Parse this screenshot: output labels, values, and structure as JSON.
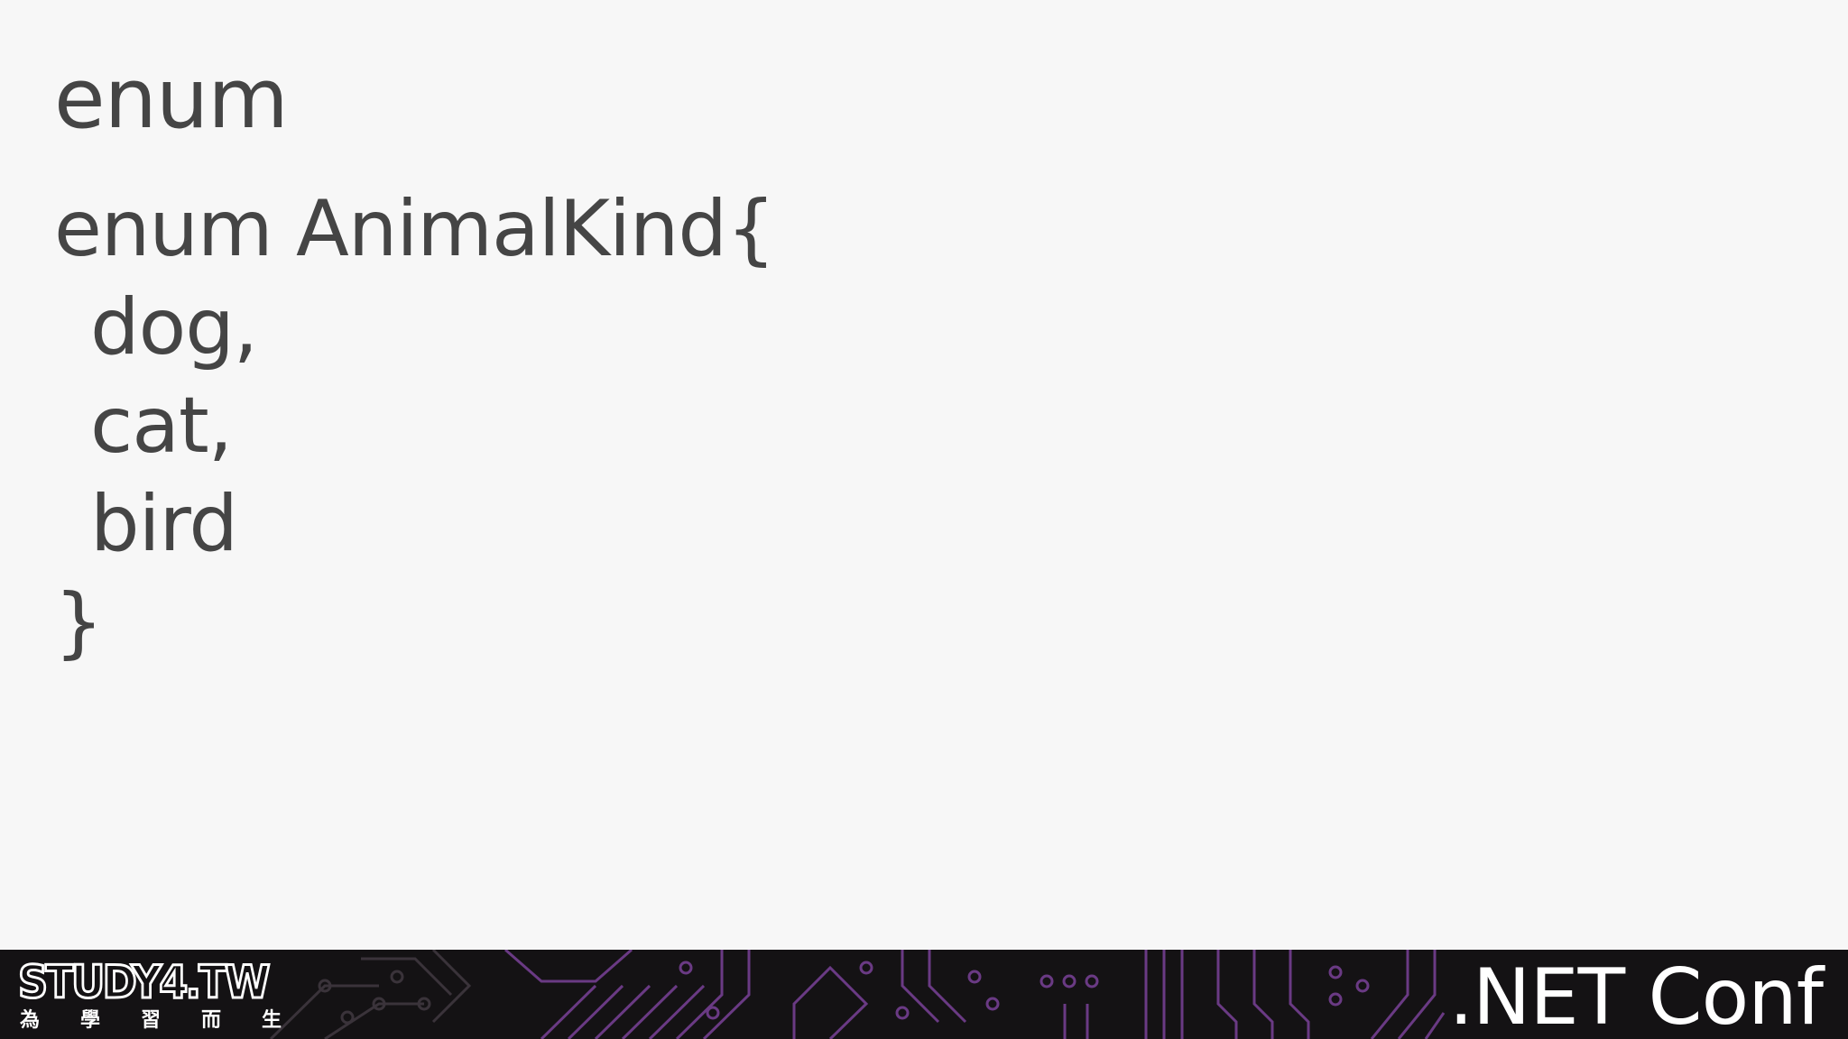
{
  "slide": {
    "title": "enum",
    "code_lines": [
      {
        "text": "enum AnimalKind{",
        "indent": false
      },
      {
        "text": "dog,",
        "indent": true
      },
      {
        "text": "cat,",
        "indent": true
      },
      {
        "text": "bird",
        "indent": true
      },
      {
        "text": "}",
        "indent": false
      }
    ]
  },
  "footer": {
    "logo_text": "STUDY4.TW",
    "logo_subtitle": [
      "為",
      "學",
      "習",
      "而",
      "生"
    ],
    "event_name": ".NET Conf",
    "background_color": "#141214",
    "circuit_color": "#a04fc0"
  },
  "colors": {
    "slide_background": "#f7f7f7",
    "text": "#454545"
  }
}
